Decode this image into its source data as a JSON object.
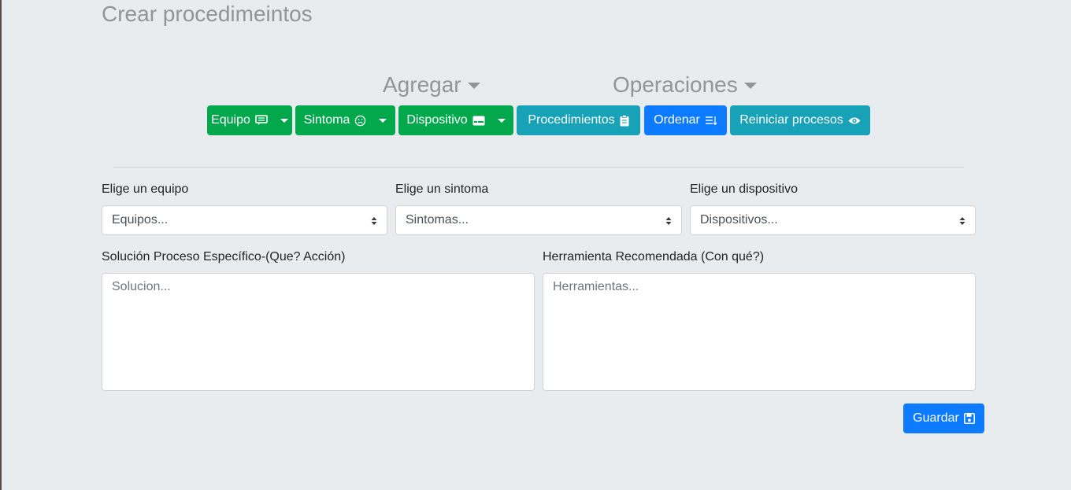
{
  "page": {
    "title": "Crear procedimeintos"
  },
  "menus": {
    "agregar": "Agregar",
    "operaciones": "Operaciones"
  },
  "toolbar": {
    "equipo": "Equipo",
    "sintoma": "Sintoma",
    "dispositivo": "Dispositivo",
    "procedimientos": "Procedimientos",
    "ordenar": "Ordenar",
    "reiniciar": "Reiniciar procesos"
  },
  "form": {
    "equipo_label": "Elige un equipo",
    "equipo_value": "Equipos...",
    "sintoma_label": "Elige un sintoma",
    "sintoma_value": "Sintomas...",
    "dispositivo_label": "Elige un dispositivo",
    "dispositivo_value": "Dispositivos...",
    "solucion_label": "Solución Proceso Específico-(Que? Acción)",
    "solucion_placeholder": "Solucion...",
    "herramienta_label": "Herramienta Recomendada (Con qué?)",
    "herramienta_placeholder": "Herramientas...",
    "save_label": "Guardar"
  },
  "colors": {
    "green": "#03a84d",
    "teal": "#17a2b8",
    "blue": "#0d7bff",
    "background": "#e9ecef"
  }
}
